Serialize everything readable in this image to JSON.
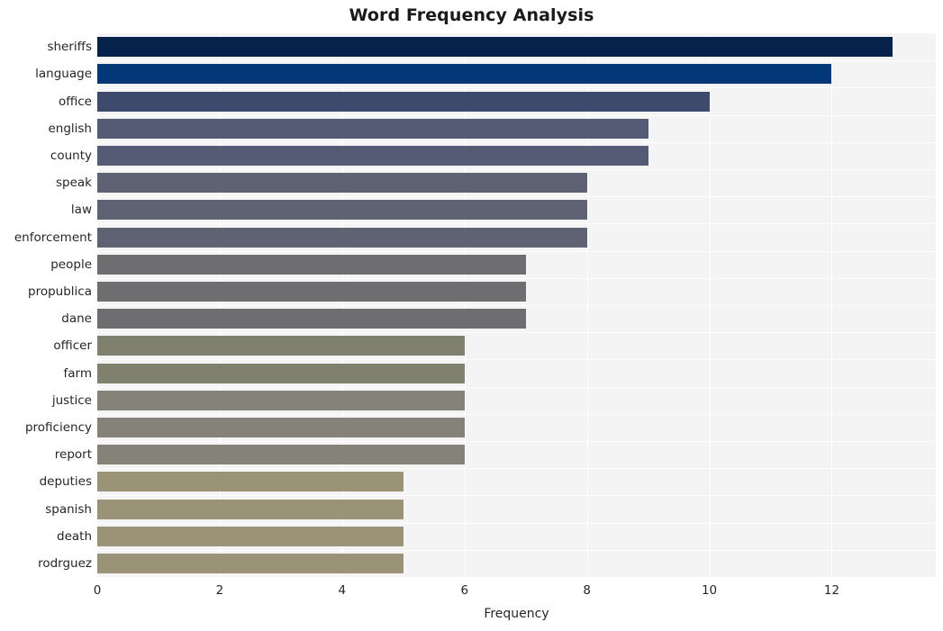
{
  "chart_data": {
    "type": "bar",
    "orientation": "horizontal",
    "title": "Word Frequency Analysis",
    "xlabel": "Frequency",
    "ylabel": "",
    "categories": [
      "sheriffs",
      "language",
      "office",
      "english",
      "county",
      "speak",
      "law",
      "enforcement",
      "people",
      "propublica",
      "dane",
      "officer",
      "farm",
      "justice",
      "proficiency",
      "report",
      "deputies",
      "spanish",
      "death",
      "rodrguez"
    ],
    "values": [
      13,
      12,
      10,
      9,
      9,
      8,
      8,
      8,
      7,
      7,
      7,
      6,
      6,
      6,
      6,
      6,
      5,
      5,
      5,
      5
    ],
    "bar_colors": [
      "#05224b",
      "#033878",
      "#3e4a6b",
      "#555b74",
      "#555b74",
      "#5f6273",
      "#5f6273",
      "#5f6273",
      "#6e6e70",
      "#6e6e70",
      "#6e6e70",
      "#80806f",
      "#80806f",
      "#85827a",
      "#85827a",
      "#85827a",
      "#9a9377",
      "#9a9377",
      "#9a9377",
      "#9a9377"
    ],
    "xticks": [
      0,
      2,
      4,
      6,
      8,
      10,
      12
    ],
    "xlim": [
      0,
      13.7
    ],
    "grid": true,
    "legend": "none",
    "plot_background": "#f4f4f5",
    "gridline_color": "#ffffff",
    "figure_background": "#ffffff"
  }
}
